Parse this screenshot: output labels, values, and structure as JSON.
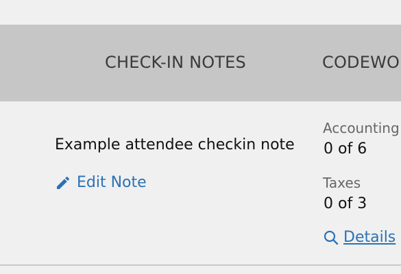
{
  "table": {
    "headers": {
      "checkin_notes": "CHECK-IN NOTES",
      "codewords": "CODEWO"
    },
    "row": {
      "note": "Example attendee checkin note",
      "edit_note_label": "Edit Note",
      "accounting_label": "Accounting",
      "accounting_value": "0 of 6",
      "taxes_label": "Taxes",
      "taxes_value": "0 of 3",
      "details_label": "Details"
    }
  },
  "colors": {
    "header_bg": "#c6c6c6",
    "link": "#2a72b5",
    "page_bg": "#f0f0f0"
  },
  "icons": {
    "edit": "pencil-icon",
    "details": "search-icon"
  }
}
